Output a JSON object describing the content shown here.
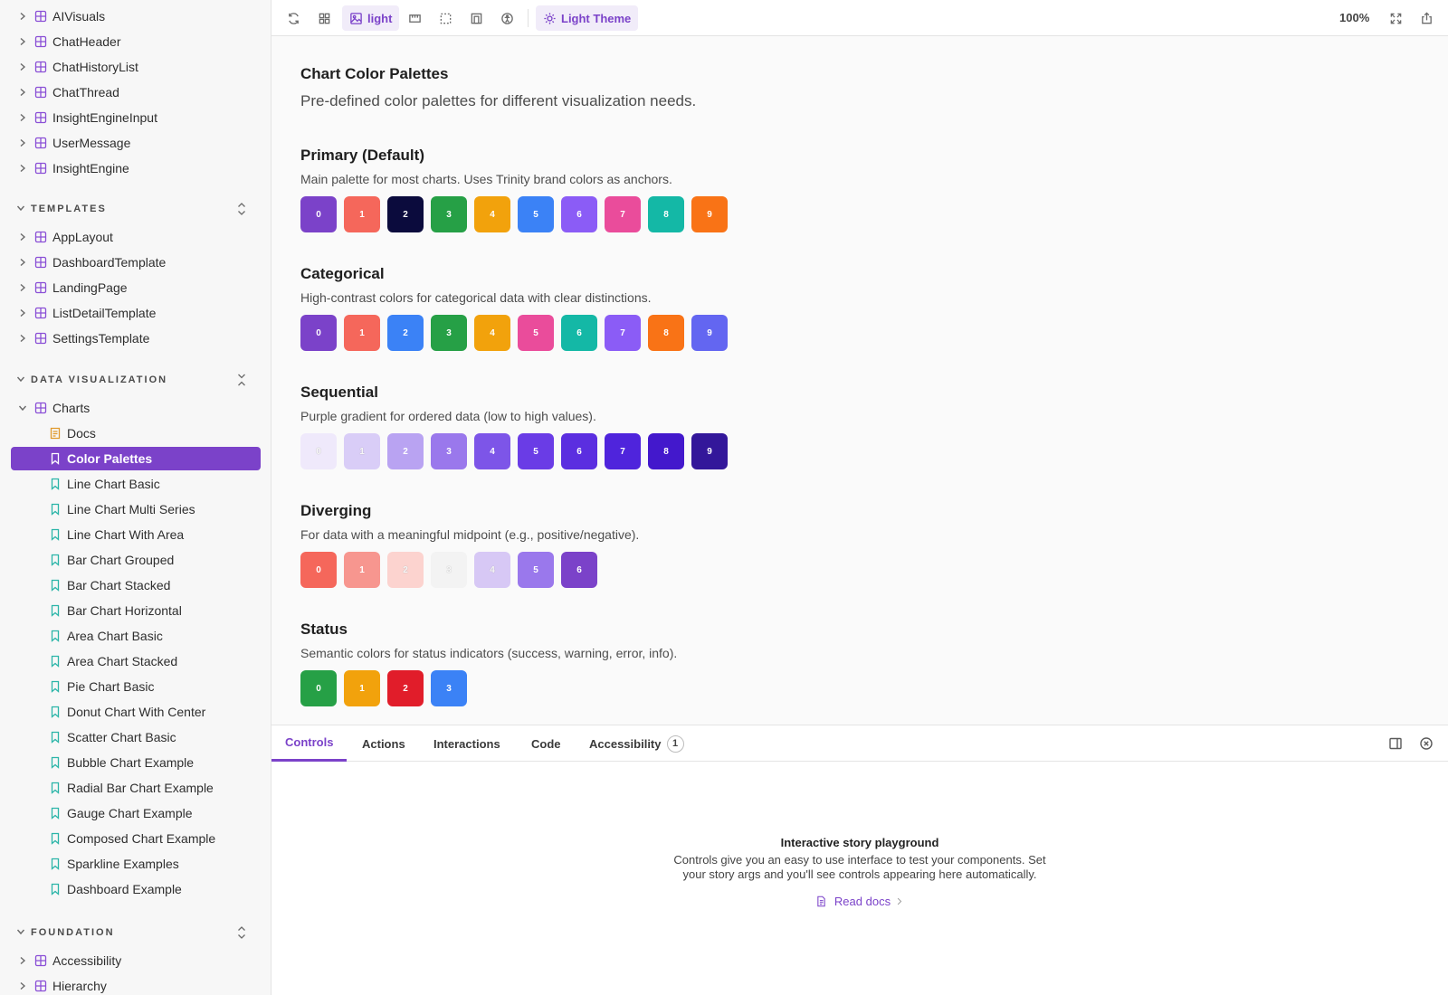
{
  "sidebar": {
    "top_components": [
      "AIVisuals",
      "ChatHeader",
      "ChatHistoryList",
      "ChatThread",
      "InsightEngineInput",
      "UserMessage",
      "InsightEngine"
    ],
    "templates_heading": "TEMPLATES",
    "templates": [
      "AppLayout",
      "DashboardTemplate",
      "LandingPage",
      "ListDetailTemplate",
      "SettingsTemplate"
    ],
    "dataviz_heading": "DATA VISUALIZATION",
    "charts_label": "Charts",
    "charts_docs": "Docs",
    "charts_stories": [
      "Color Palettes",
      "Line Chart Basic",
      "Line Chart Multi Series",
      "Line Chart With Area",
      "Bar Chart Grouped",
      "Bar Chart Stacked",
      "Bar Chart Horizontal",
      "Area Chart Basic",
      "Area Chart Stacked",
      "Pie Chart Basic",
      "Donut Chart With Center",
      "Scatter Chart Basic",
      "Bubble Chart Example",
      "Radial Bar Chart Example",
      "Gauge Chart Example",
      "Composed Chart Example",
      "Sparkline Examples",
      "Dashboard Example"
    ],
    "selected_story": "Color Palettes",
    "foundation_heading": "FOUNDATION",
    "foundation": [
      "Accessibility",
      "Hierarchy"
    ]
  },
  "toolbar": {
    "background_label": "light",
    "theme_label": "Light Theme",
    "zoom": "100%"
  },
  "page": {
    "title": "Chart Color Palettes",
    "subtitle": "Pre-defined color palettes for different visualization needs."
  },
  "palettes": [
    {
      "title": "Primary (Default)",
      "description": "Main palette for most charts. Uses Trinity brand colors as anchors.",
      "colors": [
        "#7b42c9",
        "#f5675b",
        "#0b0b3d",
        "#26a046",
        "#f2a20c",
        "#3b82f6",
        "#8b5cf6",
        "#ea4c9b",
        "#14b8a6",
        "#f97316"
      ]
    },
    {
      "title": "Categorical",
      "description": "High-contrast colors for categorical data with clear distinctions.",
      "colors": [
        "#7b42c9",
        "#f5675b",
        "#3b82f6",
        "#26a046",
        "#f2a20c",
        "#ea4c9b",
        "#14b8a6",
        "#8b5cf6",
        "#f97316",
        "#6366f1"
      ]
    },
    {
      "title": "Sequential",
      "description": "Purple gradient for ordered data (low to high values).",
      "colors": [
        "#efe9fb",
        "#d9cdf7",
        "#b9a3f2",
        "#9a78ec",
        "#7d55e8",
        "#6a3ce6",
        "#5b2ee0",
        "#4f24dc",
        "#4318cc",
        "#33179a"
      ]
    },
    {
      "title": "Diverging",
      "description": "For data with a meaningful midpoint (e.g., positive/negative).",
      "colors": [
        "#f5675b",
        "#f7968f",
        "#fcd3cf",
        "#f3f3f3",
        "#d7c8f5",
        "#9a78ec",
        "#7b42c9"
      ]
    },
    {
      "title": "Status",
      "description": "Semantic colors for status indicators (success, warning, error, info).",
      "colors": [
        "#26a046",
        "#f2a20c",
        "#e11d2a",
        "#3b82f6"
      ]
    }
  ],
  "addons": {
    "tabs": [
      "Controls",
      "Actions",
      "Interactions",
      "Code",
      "Accessibility"
    ],
    "accessibility_count": "1",
    "empty_title": "Interactive story playground",
    "empty_desc": "Controls give you an easy to use interface to test your components. Set your story args and you'll see controls appearing here automatically.",
    "read_docs": "Read docs"
  }
}
